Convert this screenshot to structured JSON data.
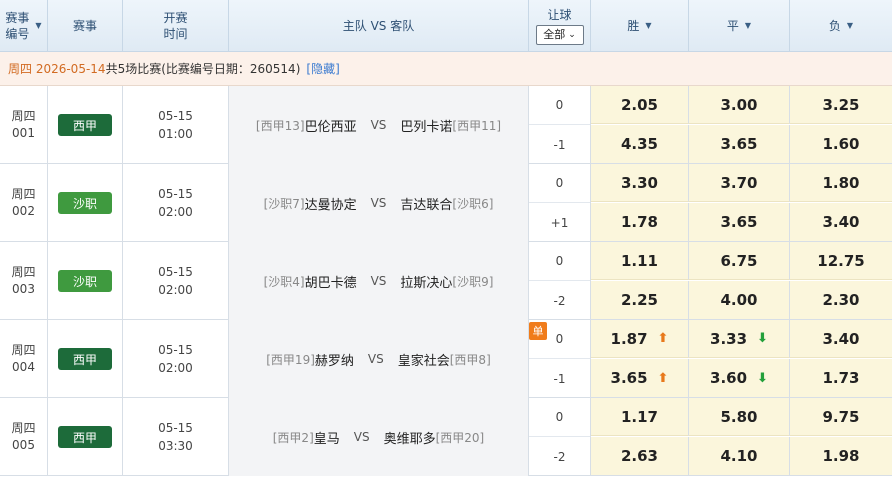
{
  "header": {
    "num": [
      "赛事",
      "编号"
    ],
    "league": "赛事",
    "time": [
      "开赛",
      "时间"
    ],
    "teams": "主队 VS 客队",
    "handicap": "让球",
    "handicap_select": "全部",
    "win": "胜",
    "draw": "平",
    "lose": "负"
  },
  "info": {
    "date": "周四 2026-05-14",
    "count": " 共5场比赛",
    "detail": "(比赛编号日期：260514)",
    "hide": "[隐藏]"
  },
  "colors": {
    "laliga": "#1d6b3a",
    "saudi": "#3f9a3f",
    "accent": "#d26b22"
  },
  "matches": [
    {
      "day": "周四",
      "num": "001",
      "league": "西甲",
      "league_color": "#1d6b3a",
      "date": "05-15",
      "time": "01:00",
      "home_rank": "[西甲13]",
      "home": "巴伦西亚",
      "vs": "VS",
      "away": "巴列卡诺",
      "away_rank": "[西甲11]",
      "hcp": [
        "0",
        "-1"
      ],
      "odds": [
        {
          "w": "2.05",
          "d": "3.00",
          "l": "3.25"
        },
        {
          "w": "4.35",
          "d": "3.65",
          "l": "1.60"
        }
      ]
    },
    {
      "day": "周四",
      "num": "002",
      "league": "沙职",
      "league_color": "#3f9a3f",
      "date": "05-15",
      "time": "02:00",
      "home_rank": "[沙职7]",
      "home": "达曼协定",
      "vs": "VS",
      "away": "吉达联合",
      "away_rank": "[沙职6]",
      "hcp": [
        "0",
        "+1"
      ],
      "odds": [
        {
          "w": "3.30",
          "d": "3.70",
          "l": "1.80"
        },
        {
          "w": "1.78",
          "d": "3.65",
          "l": "3.40"
        }
      ]
    },
    {
      "day": "周四",
      "num": "003",
      "league": "沙职",
      "league_color": "#3f9a3f",
      "date": "05-15",
      "time": "02:00",
      "home_rank": "[沙职4]",
      "home": "胡巴卡德",
      "vs": "VS",
      "away": "拉斯决心",
      "away_rank": "[沙职9]",
      "hcp": [
        "0",
        "-2"
      ],
      "odds": [
        {
          "w": "1.11",
          "d": "6.75",
          "l": "12.75"
        },
        {
          "w": "2.25",
          "d": "4.00",
          "l": "2.30"
        }
      ]
    },
    {
      "day": "周四",
      "num": "004",
      "league": "西甲",
      "league_color": "#1d6b3a",
      "date": "05-15",
      "time": "02:00",
      "home_rank": "[西甲19]",
      "home": "赫罗纳",
      "vs": "VS",
      "away": "皇家社会",
      "away_rank": "[西甲8]",
      "single": "单",
      "hcp": [
        "0",
        "-1"
      ],
      "odds": [
        {
          "w": "1.87",
          "d": "3.33",
          "l": "3.40",
          "w_trend": "up",
          "d_trend": "down"
        },
        {
          "w": "3.65",
          "d": "3.60",
          "l": "1.73",
          "w_trend": "up",
          "d_trend": "down"
        }
      ]
    },
    {
      "day": "周四",
      "num": "005",
      "league": "西甲",
      "league_color": "#1d6b3a",
      "date": "05-15",
      "time": "03:30",
      "home_rank": "[西甲2]",
      "home": "皇马",
      "vs": "VS",
      "away": "奥维耶多",
      "away_rank": "[西甲20]",
      "hcp": [
        "0",
        "-2"
      ],
      "odds": [
        {
          "w": "1.17",
          "d": "5.80",
          "l": "9.75"
        },
        {
          "w": "2.63",
          "d": "4.10",
          "l": "1.98"
        }
      ]
    }
  ]
}
